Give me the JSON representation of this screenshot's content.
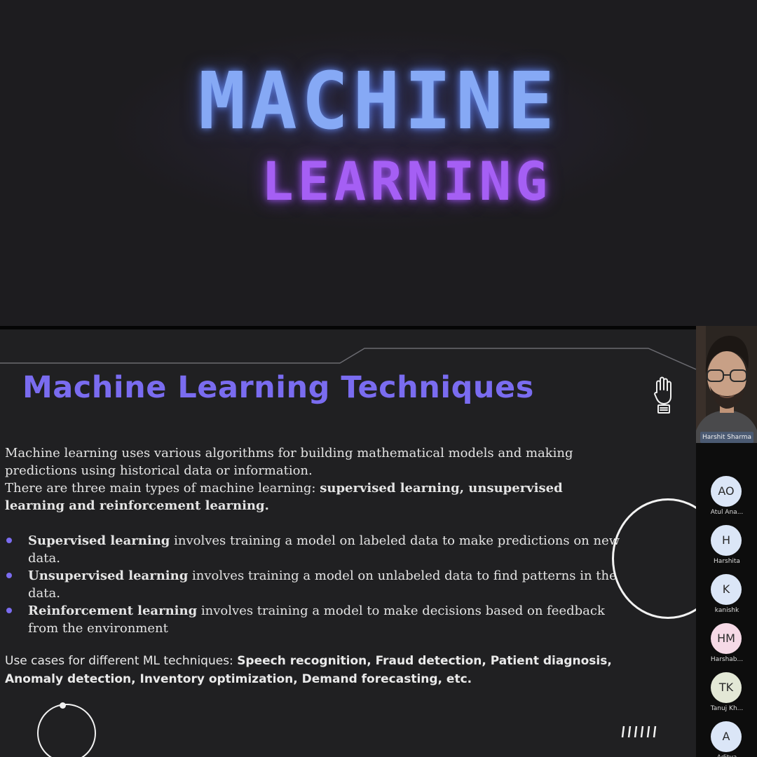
{
  "hero": {
    "line1": "MACHINE",
    "line2": "LEARNING"
  },
  "slide": {
    "title": "Machine Learning Techniques",
    "intro": [
      "Machine learning uses various algorithms for building mathematical models and making predictions using historical data or information.",
      "There are three main types of machine learning: "
    ],
    "intro_bold": "supervised learning, unsupervised learning and reinforcement learning.",
    "bullets": [
      {
        "term": "Supervised learning",
        "text": " involves training a model on labeled data to make predictions on new data."
      },
      {
        "term": "Unsupervised learning",
        "text": " involves training a model on unlabeled data to find patterns in the data."
      },
      {
        "term": "Reinforcement learning",
        "text": " involves training a model to make decisions based on feedback from the environment"
      }
    ],
    "usecases_label": "Use cases for different ML techniques: ",
    "usecases_bold": "Speech recognition, Fraud detection, Patient diagnosis, Anomaly detection, Inventory optimization, Demand forecasting, etc.",
    "accent_color": "#7a6cf0"
  },
  "meeting": {
    "presenter_name": "Harshit Sharma",
    "participants": [
      {
        "initials": "AO",
        "name": "Atul Ana...",
        "color": "#dbe6f7"
      },
      {
        "initials": "H",
        "name": "Harshita",
        "color": "#dbe6f7"
      },
      {
        "initials": "K",
        "name": "kanishk",
        "color": "#dbe6f7"
      },
      {
        "initials": "HM",
        "name": "Harshab...",
        "color": "#f5d9e6"
      },
      {
        "initials": "TK",
        "name": "Tanuj Kh...",
        "color": "#e3e8d6"
      },
      {
        "initials": "A",
        "name": "Aditya",
        "color": "#dbe6f7"
      }
    ]
  }
}
